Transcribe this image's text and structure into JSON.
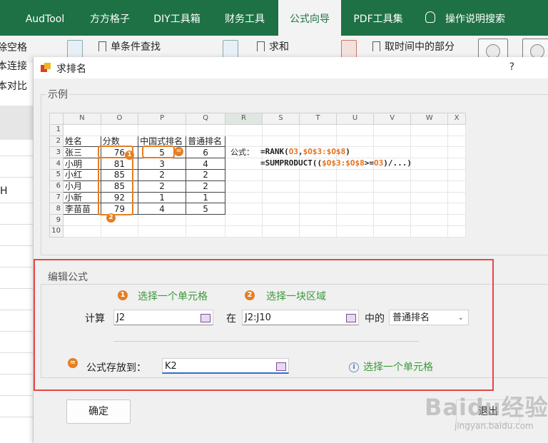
{
  "ribbon": {
    "tabs": [
      {
        "label": "AudTool",
        "active": false
      },
      {
        "label": "方方格子",
        "active": false
      },
      {
        "label": "DIY工具箱",
        "active": false
      },
      {
        "label": "财务工具",
        "active": false
      },
      {
        "label": "公式向导",
        "active": true
      },
      {
        "label": "PDF工具集",
        "active": false
      },
      {
        "label": "操作说明搜索",
        "active": false
      }
    ],
    "commands": {
      "single_lookup": "单条件查找",
      "sum": "求和",
      "extract_time": "取时间中的部分"
    }
  },
  "sheet_left": {
    "items": [
      "除空格",
      "本连接",
      "本对比"
    ],
    "col_label": "H"
  },
  "dialog": {
    "title": "求排名",
    "help": "?",
    "example_title": "示例",
    "edit_title": "编辑公式",
    "colors": {
      "accent": "#e67e22",
      "hint": "#3a9a3a",
      "highlight": "#e74646",
      "brand": "#1e7145"
    }
  },
  "sample": {
    "col_headers": [
      "N",
      "O",
      "P",
      "Q",
      "R",
      "S",
      "T",
      "U",
      "V",
      "W",
      "X"
    ],
    "row_headers": [
      "1",
      "2",
      "3",
      "4",
      "5",
      "6",
      "7",
      "8",
      "9",
      "10"
    ],
    "table_headers": [
      "姓名",
      "分数",
      "中国式排名",
      "普通排名"
    ],
    "rows": [
      [
        "张三",
        "76",
        "5",
        "6"
      ],
      [
        "小明",
        "81",
        "3",
        "4"
      ],
      [
        "小红",
        "85",
        "2",
        "2"
      ],
      [
        "小月",
        "85",
        "2",
        "2"
      ],
      [
        "小新",
        "92",
        "1",
        "1"
      ],
      [
        "李苗苗",
        "79",
        "4",
        "5"
      ]
    ],
    "formula_label": "公式：",
    "formula1": {
      "prefix": "=RANK(",
      "arg1": "O3",
      "comma": ",",
      "arg2": "$O$3:$O$8",
      "suffix": ")"
    },
    "formula2": {
      "prefix": "=SUMPRODUCT((",
      "arg1": "$O$3:$O$8",
      "mid": ">=",
      "arg2": "O3",
      "suffix": ")/...)"
    },
    "badges": [
      "1",
      "2",
      "="
    ]
  },
  "edit": {
    "hint1": "选择一个单元格",
    "hint2": "选择一块区域",
    "hint3": "选择一个单元格",
    "badge1": "1",
    "badge2": "2",
    "badge3": "=",
    "calc_label": "计算",
    "calc_value": "J2",
    "in_label": "在",
    "range_value": "J2:J10",
    "of_label": "中的",
    "rank_type": "普通排名",
    "store_label": "公式存放到：",
    "store_value": "K2",
    "info": "i"
  },
  "buttons": {
    "ok": "确定",
    "exit": "退出"
  },
  "watermark": {
    "brand": "Baidu经验",
    "site": "jingyan.baidu.com"
  }
}
